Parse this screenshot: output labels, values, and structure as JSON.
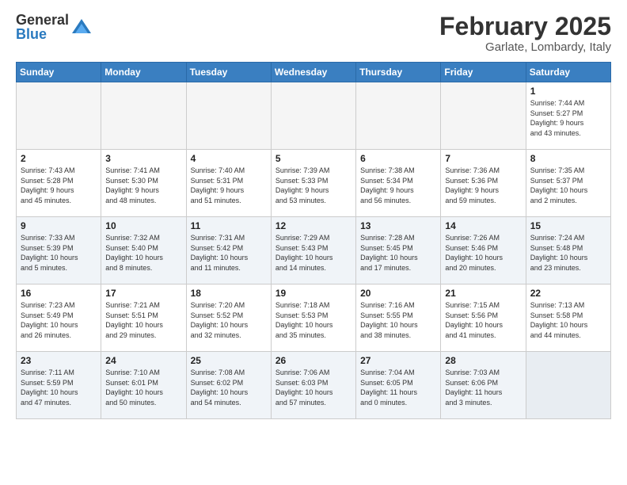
{
  "header": {
    "logo": {
      "general": "General",
      "blue": "Blue"
    },
    "title": "February 2025",
    "location": "Garlate, Lombardy, Italy"
  },
  "weekdays": [
    "Sunday",
    "Monday",
    "Tuesday",
    "Wednesday",
    "Thursday",
    "Friday",
    "Saturday"
  ],
  "weeks": [
    {
      "alt": false,
      "days": [
        {
          "num": "",
          "info": ""
        },
        {
          "num": "",
          "info": ""
        },
        {
          "num": "",
          "info": ""
        },
        {
          "num": "",
          "info": ""
        },
        {
          "num": "",
          "info": ""
        },
        {
          "num": "",
          "info": ""
        },
        {
          "num": "1",
          "info": "Sunrise: 7:44 AM\nSunset: 5:27 PM\nDaylight: 9 hours\nand 43 minutes."
        }
      ]
    },
    {
      "alt": false,
      "days": [
        {
          "num": "2",
          "info": "Sunrise: 7:43 AM\nSunset: 5:28 PM\nDaylight: 9 hours\nand 45 minutes."
        },
        {
          "num": "3",
          "info": "Sunrise: 7:41 AM\nSunset: 5:30 PM\nDaylight: 9 hours\nand 48 minutes."
        },
        {
          "num": "4",
          "info": "Sunrise: 7:40 AM\nSunset: 5:31 PM\nDaylight: 9 hours\nand 51 minutes."
        },
        {
          "num": "5",
          "info": "Sunrise: 7:39 AM\nSunset: 5:33 PM\nDaylight: 9 hours\nand 53 minutes."
        },
        {
          "num": "6",
          "info": "Sunrise: 7:38 AM\nSunset: 5:34 PM\nDaylight: 9 hours\nand 56 minutes."
        },
        {
          "num": "7",
          "info": "Sunrise: 7:36 AM\nSunset: 5:36 PM\nDaylight: 9 hours\nand 59 minutes."
        },
        {
          "num": "8",
          "info": "Sunrise: 7:35 AM\nSunset: 5:37 PM\nDaylight: 10 hours\nand 2 minutes."
        }
      ]
    },
    {
      "alt": true,
      "days": [
        {
          "num": "9",
          "info": "Sunrise: 7:33 AM\nSunset: 5:39 PM\nDaylight: 10 hours\nand 5 minutes."
        },
        {
          "num": "10",
          "info": "Sunrise: 7:32 AM\nSunset: 5:40 PM\nDaylight: 10 hours\nand 8 minutes."
        },
        {
          "num": "11",
          "info": "Sunrise: 7:31 AM\nSunset: 5:42 PM\nDaylight: 10 hours\nand 11 minutes."
        },
        {
          "num": "12",
          "info": "Sunrise: 7:29 AM\nSunset: 5:43 PM\nDaylight: 10 hours\nand 14 minutes."
        },
        {
          "num": "13",
          "info": "Sunrise: 7:28 AM\nSunset: 5:45 PM\nDaylight: 10 hours\nand 17 minutes."
        },
        {
          "num": "14",
          "info": "Sunrise: 7:26 AM\nSunset: 5:46 PM\nDaylight: 10 hours\nand 20 minutes."
        },
        {
          "num": "15",
          "info": "Sunrise: 7:24 AM\nSunset: 5:48 PM\nDaylight: 10 hours\nand 23 minutes."
        }
      ]
    },
    {
      "alt": false,
      "days": [
        {
          "num": "16",
          "info": "Sunrise: 7:23 AM\nSunset: 5:49 PM\nDaylight: 10 hours\nand 26 minutes."
        },
        {
          "num": "17",
          "info": "Sunrise: 7:21 AM\nSunset: 5:51 PM\nDaylight: 10 hours\nand 29 minutes."
        },
        {
          "num": "18",
          "info": "Sunrise: 7:20 AM\nSunset: 5:52 PM\nDaylight: 10 hours\nand 32 minutes."
        },
        {
          "num": "19",
          "info": "Sunrise: 7:18 AM\nSunset: 5:53 PM\nDaylight: 10 hours\nand 35 minutes."
        },
        {
          "num": "20",
          "info": "Sunrise: 7:16 AM\nSunset: 5:55 PM\nDaylight: 10 hours\nand 38 minutes."
        },
        {
          "num": "21",
          "info": "Sunrise: 7:15 AM\nSunset: 5:56 PM\nDaylight: 10 hours\nand 41 minutes."
        },
        {
          "num": "22",
          "info": "Sunrise: 7:13 AM\nSunset: 5:58 PM\nDaylight: 10 hours\nand 44 minutes."
        }
      ]
    },
    {
      "alt": true,
      "days": [
        {
          "num": "23",
          "info": "Sunrise: 7:11 AM\nSunset: 5:59 PM\nDaylight: 10 hours\nand 47 minutes."
        },
        {
          "num": "24",
          "info": "Sunrise: 7:10 AM\nSunset: 6:01 PM\nDaylight: 10 hours\nand 50 minutes."
        },
        {
          "num": "25",
          "info": "Sunrise: 7:08 AM\nSunset: 6:02 PM\nDaylight: 10 hours\nand 54 minutes."
        },
        {
          "num": "26",
          "info": "Sunrise: 7:06 AM\nSunset: 6:03 PM\nDaylight: 10 hours\nand 57 minutes."
        },
        {
          "num": "27",
          "info": "Sunrise: 7:04 AM\nSunset: 6:05 PM\nDaylight: 11 hours\nand 0 minutes."
        },
        {
          "num": "28",
          "info": "Sunrise: 7:03 AM\nSunset: 6:06 PM\nDaylight: 11 hours\nand 3 minutes."
        },
        {
          "num": "",
          "info": ""
        }
      ]
    }
  ]
}
